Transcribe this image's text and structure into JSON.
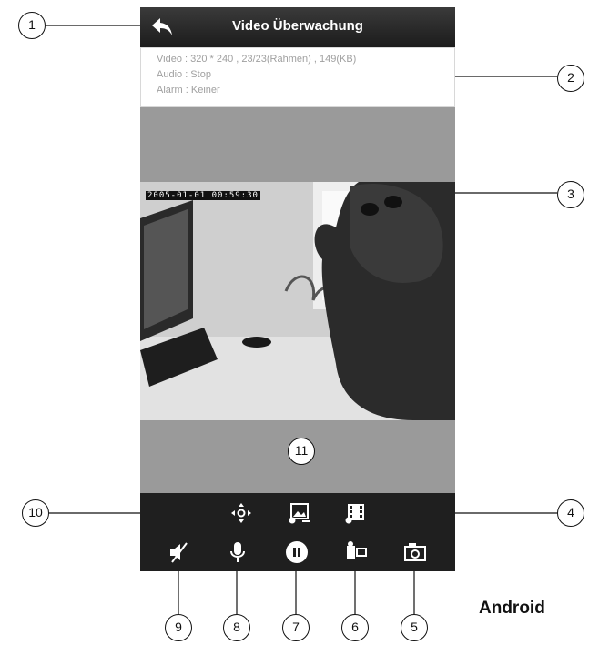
{
  "header": {
    "title": "Video Überwachung"
  },
  "info": {
    "video_line": "Video : 320 * 240  , 23/23(Rahmen) , 149(KB)",
    "audio_line": "Audio : Stop",
    "alarm_line": "Alarm : Keiner"
  },
  "stream": {
    "timestamp": "2005-01-01 00:59:30"
  },
  "toolbar_top": {
    "icons": [
      "ptz-control-icon",
      "image-settings-icon",
      "video-settings-icon"
    ]
  },
  "toolbar_bottom": {
    "icons": [
      "mute-icon",
      "microphone-icon",
      "pause-icon",
      "record-icon",
      "snapshot-icon"
    ]
  },
  "callouts": {
    "c1": "1",
    "c2": "2",
    "c3": "3",
    "c4": "4",
    "c5": "5",
    "c6": "6",
    "c7": "7",
    "c8": "8",
    "c9": "9",
    "c10": "10",
    "c11": "11"
  },
  "platform_label": "Android",
  "colors": {
    "bar": "#1f1f1f",
    "accent": "#ffffff",
    "viewer_bg": "#9a9a9a"
  }
}
